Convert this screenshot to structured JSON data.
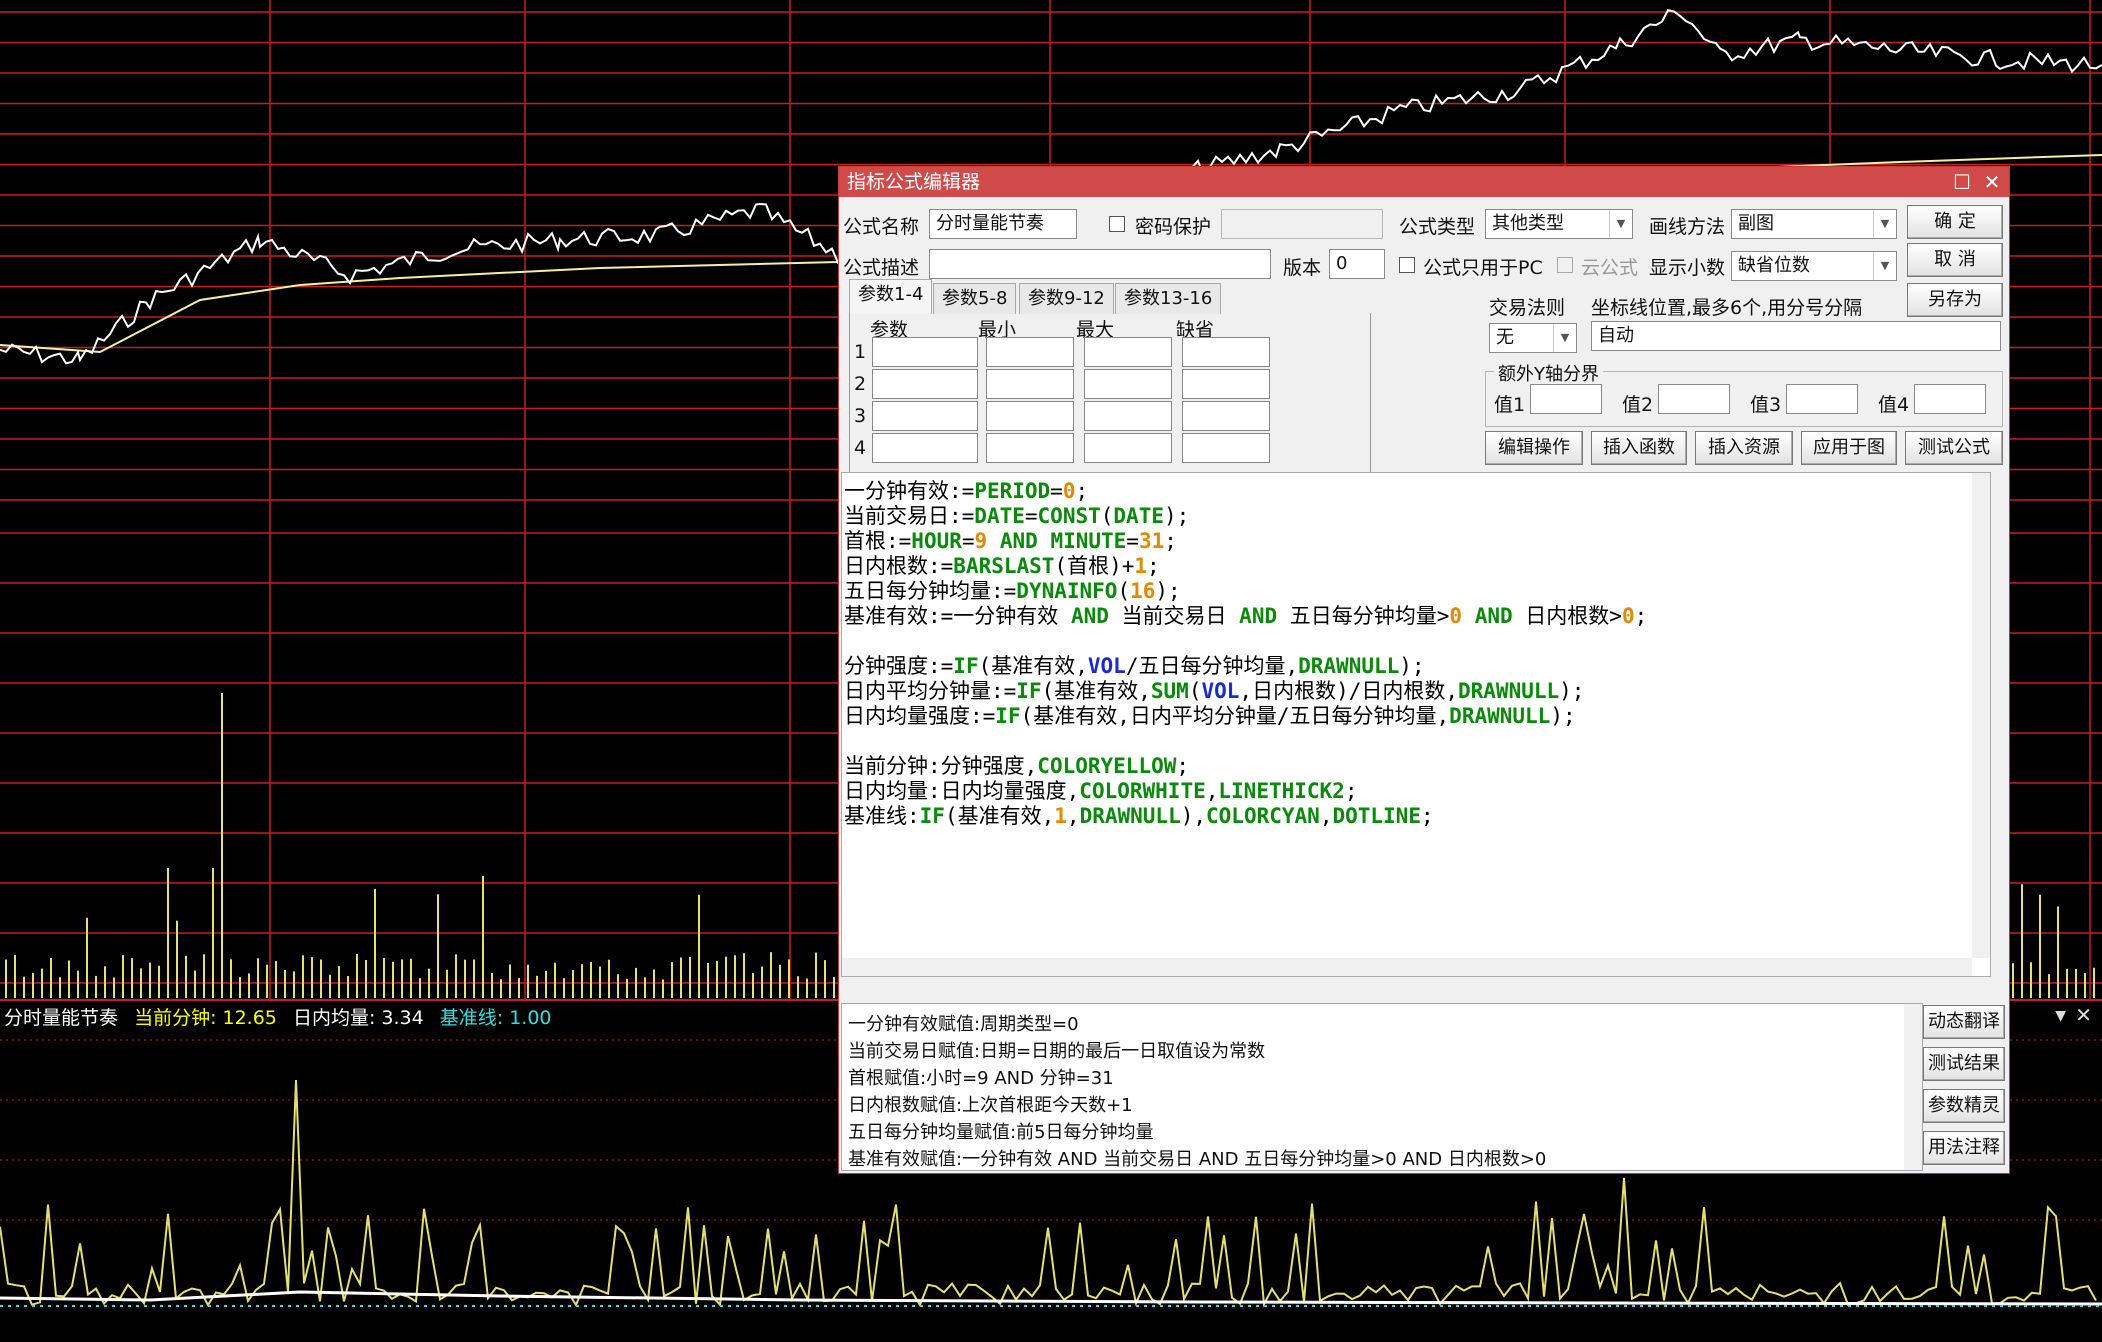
{
  "colors": {
    "grid_red": "#c81e1e",
    "price_white": "#ffffff",
    "avg_yellow": "#f5f0a0",
    "volume_yellow": "#e6e070",
    "label_yellow": "#ffff00",
    "label_white": "#ffffff",
    "label_cyan": "#2ee0e0",
    "dialog_title_bg": "#d14a4a"
  },
  "indicator_label": {
    "name": "分时量能节奏",
    "series1": "当前分钟: 12.65",
    "series2": "日内均量: 3.34",
    "series3": "基准线: 1.00"
  },
  "pane_controls": {
    "dropdown_icon": "▼",
    "close_icon": "✕"
  },
  "dialog": {
    "title": "指标公式编辑器",
    "maximize_icon": "☐",
    "close_icon": "✕",
    "formula_name_label": "公式名称",
    "formula_name_value": "分时量能节奏",
    "password_label": "密码保护",
    "password_value": "",
    "formula_type_label": "公式类型",
    "formula_type_value": "其他类型",
    "draw_method_label": "画线方法",
    "draw_method_value": "副图",
    "ok_button": "确  定",
    "desc_label": "公式描述",
    "desc_value": "",
    "version_label": "版本",
    "version_value": "0",
    "pc_only_label": "公式只用于PC",
    "cloud_label": "云公式",
    "decimals_label": "显示小数",
    "decimals_value": "缺省位数",
    "cancel_button": "取  消",
    "save_as_button": "另存为",
    "tabs": [
      "参数1-4",
      "参数5-8",
      "参数9-12",
      "参数13-16"
    ],
    "param_headers": [
      "参数",
      "最小",
      "最大",
      "缺省"
    ],
    "param_rows": [
      "1",
      "2",
      "3",
      "4"
    ],
    "trade_rule_label": "交易法则",
    "trade_rule_value": "无",
    "axis_label": "坐标线位置,最多6个,用分号分隔",
    "axis_value": "自动",
    "y_axis_group": "额外Y轴分界",
    "y_values": [
      "值1",
      "值2",
      "值3",
      "值4"
    ],
    "buttons": [
      "编辑操作",
      "插入函数",
      "插入资源",
      "应用于图",
      "测试公式"
    ],
    "side_buttons": [
      "动态翻译",
      "测试结果",
      "参数精灵",
      "用法注释"
    ],
    "code_lines": [
      "一分钟有效:=PERIOD=0;",
      "当前交易日:=DATE=CONST(DATE);",
      "首根:=HOUR=9 AND MINUTE=31;",
      "日内根数:=BARSLAST(首根)+1;",
      "五日每分钟均量:=DYNAINFO(16);",
      "基准有效:=一分钟有效 AND 当前交易日 AND 五日每分钟均量>0 AND 日内根数>0;",
      "",
      "分钟强度:=IF(基准有效,VOL/五日每分钟均量,DRAWNULL);",
      "日内平均分钟量:=IF(基准有效,SUM(VOL,日内根数)/日内根数,DRAWNULL);",
      "日内均量强度:=IF(基准有效,日内平均分钟量/五日每分钟均量,DRAWNULL);",
      "",
      "当前分钟:分钟强度,COLORYELLOW;",
      "日内均量:日内均量强度,COLORWHITE,LINETHICK2;",
      "基准线:IF(基准有效,1,DRAWNULL),COLORCYAN,DOTLINE;"
    ],
    "translation_lines": [
      "一分钟有效赋值:周期类型=0",
      "当前交易日赋值:日期=日期的最后一日取值设为常数",
      "首根赋值:小时=9 AND 分钟=31",
      "日内根数赋值:上次首根距今天数+1",
      "五日每分钟均量赋值:前5日每分钟均量",
      "基准有效赋值:一分钟有效 AND 当前交易日 AND 五日每分钟均量>0 AND 日内根数>0"
    ]
  }
}
